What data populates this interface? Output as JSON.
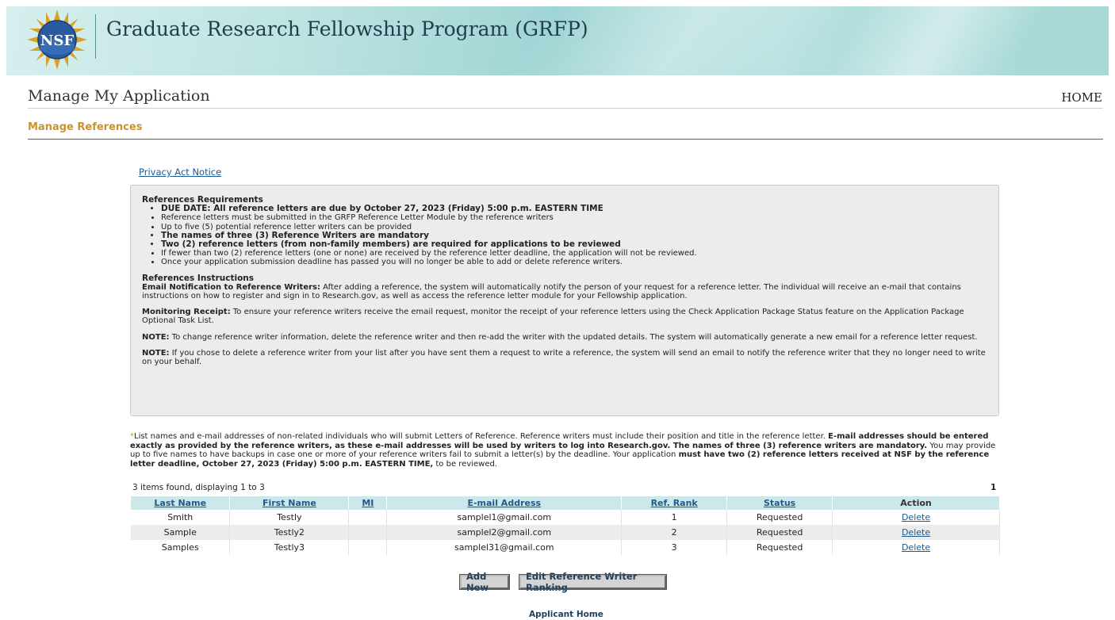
{
  "banner": {
    "logo_text": "NSF",
    "title": "Graduate Research Fellowship Program (GRFP)"
  },
  "header": {
    "page_title": "Manage My Application",
    "home_link": "HOME",
    "section_title": "Manage References"
  },
  "privacy_link": "Privacy Act Notice",
  "requirements": {
    "heading": "References Requirements",
    "items": [
      {
        "text": "DUE DATE: All reference letters are due by October 27, 2023 (Friday) 5:00 p.m. EASTERN TIME",
        "bold": true
      },
      {
        "text": "Reference letters must be submitted in the GRFP Reference Letter Module by the reference writers",
        "bold": false
      },
      {
        "text": "Up to five (5) potential reference letter writers can be provided",
        "bold": false
      },
      {
        "text": "The names of three (3) Reference Writers are mandatory",
        "bold": true
      },
      {
        "text": "Two (2) reference letters (from non-family members) are required for applications to be reviewed",
        "bold": true
      },
      {
        "text": "If fewer than two (2) reference letters (one or none) are received by the reference letter deadline, the application will not be reviewed.",
        "bold": false
      },
      {
        "text": "Once your application submission deadline has passed you will no longer be able to add or delete reference writers.",
        "bold": false
      }
    ]
  },
  "instructions": {
    "heading": "References Instructions",
    "email_label": "Email Notification to Reference Writers:",
    "email_text": " After adding a reference, the system will automatically notify the person of your request for a reference letter. The individual will receive an e-mail that contains instructions on how to register and sign in to Research.gov, as well as access the reference letter module for your Fellowship application.",
    "monitor_label": "Monitoring Receipt:",
    "monitor_text": " To ensure your reference writers receive the email request, monitor the receipt of your reference letters using the Check Application Package Status feature on the Application Package Optional Task List.",
    "note1_label": "NOTE:",
    "note1_text": " To change reference writer information, delete the reference writer and then re-add the writer with the updated details. The system will automatically generate a new email for a reference letter request.",
    "note2_label": "NOTE:",
    "note2_text": " If you chose to delete a reference writer from your list after you have sent them a request to write a reference, the system will send an email to notify the reference writer that they no longer need to write on your behalf."
  },
  "notice": {
    "star": "*",
    "part1": "List names and e-mail addresses of non-related individuals who will submit Letters of Reference. Reference writers must include their position and title in the reference letter. ",
    "part2": "E-mail addresses should be entered exactly as provided by the reference writers, as these e-mail addresses will be used by writers to log into Research.gov. The names of three (3) reference writers are mandatory.",
    "part3": " You may provide up to five names to have backups in case one or more of your reference writers fail to submit a letter(s) by the deadline. Your application ",
    "part4": "must have two (2) reference letters received at NSF by the reference letter deadline, October 27, 2023 (Friday) 5:00 p.m. EASTERN TIME,",
    "part5": " to be reviewed."
  },
  "table": {
    "count_text": "3 items found, displaying 1 to 3",
    "page_number": "1",
    "columns": [
      "Last Name",
      "First Name",
      "MI",
      "E-mail Address",
      "Ref. Rank",
      "Status",
      "Action"
    ],
    "rows": [
      {
        "last": "Smith",
        "first": "Testly",
        "mi": "",
        "email": "samplel1@gmail.com",
        "rank": "1",
        "status": "Requested",
        "action": "Delete"
      },
      {
        "last": "Sample",
        "first": "Testly2",
        "mi": "",
        "email": "samplel2@gmail.com",
        "rank": "2",
        "status": "Requested",
        "action": "Delete"
      },
      {
        "last": "Samples",
        "first": "Testly3",
        "mi": "",
        "email": "samplel31@gmail.com",
        "rank": "3",
        "status": "Requested",
        "action": "Delete"
      }
    ]
  },
  "buttons": {
    "add_new": "Add New",
    "edit_ranking": "Edit Reference Writer Ranking"
  },
  "footer": {
    "applicant_home": "Applicant Home"
  },
  "colors": {
    "section_title": "#c8922f",
    "link": "#1a5a93",
    "table_header_bg": "#cde8ea",
    "divider_blue": "#2b6f9a"
  }
}
